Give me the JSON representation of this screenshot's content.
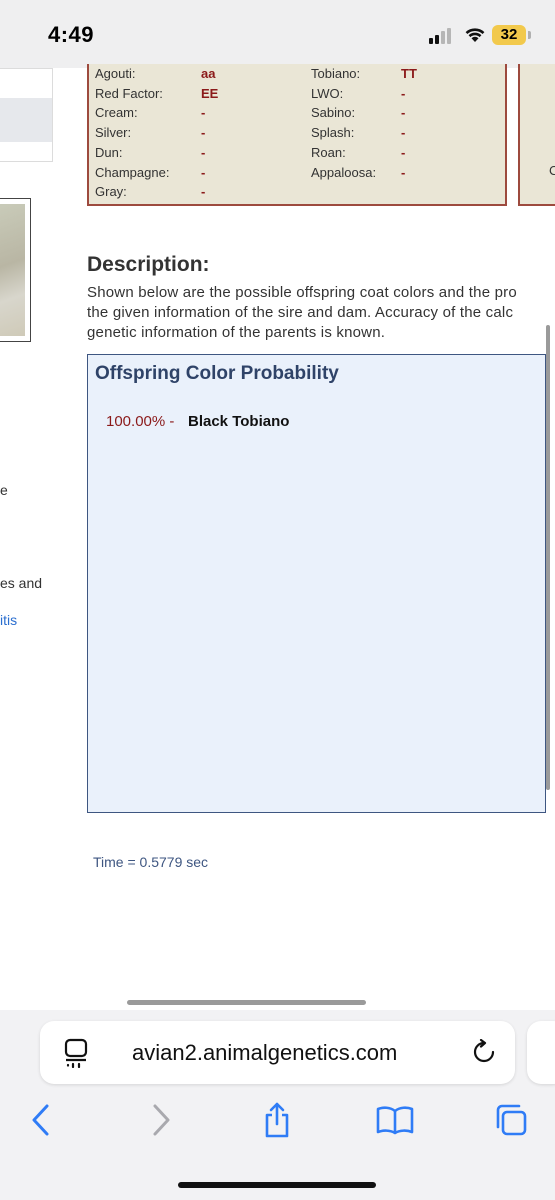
{
  "status_bar": {
    "time": "4:49",
    "battery": "32",
    "icons": [
      "signal-icon",
      "wifi-icon",
      "battery-icon"
    ]
  },
  "left_column": {
    "text_1": "e",
    "text_2": "es and",
    "link_3": "itis"
  },
  "genetics": {
    "left": [
      {
        "label": "Agouti:",
        "value": "aa"
      },
      {
        "label": "Red Factor:",
        "value": "EE"
      },
      {
        "label": "Cream:",
        "value": "-"
      },
      {
        "label": "Silver:",
        "value": "-"
      },
      {
        "label": "Dun:",
        "value": "-"
      },
      {
        "label": "Champagne:",
        "value": "-"
      },
      {
        "label": "Gray:",
        "value": "-"
      }
    ],
    "right": [
      {
        "label": "Tobiano:",
        "value": "TT"
      },
      {
        "label": "LWO:",
        "value": "-"
      },
      {
        "label": "Sabino:",
        "value": "-"
      },
      {
        "label": "Splash:",
        "value": "-"
      },
      {
        "label": "Roan:",
        "value": "-"
      },
      {
        "label": "Appaloosa:",
        "value": "-"
      }
    ],
    "clipped_letter": "C"
  },
  "description": {
    "title": "Description:",
    "lines": [
      "Shown below are the possible offspring coat colors and the pro",
      "the given information of the sire and dam. Accuracy of the calc",
      "genetic information of the parents is known."
    ]
  },
  "offspring": {
    "title": "Offspring Color Probability",
    "results": [
      {
        "percent": "100.00% -",
        "color": "Black Tobiano"
      }
    ]
  },
  "timing": "Time = 0.5779 sec",
  "browser": {
    "url": "avian2.animalgenetics.com",
    "icons": [
      "tab-overview-icon",
      "reload-icon",
      "back-icon",
      "forward-icon",
      "share-icon",
      "bookmarks-icon",
      "tabs-icon"
    ]
  },
  "colors": {
    "gene_box_bg": "#eae6d6",
    "gene_box_border": "#9d4a3e",
    "gene_value": "#8b1a1a",
    "offspring_bg": "#eaf1fb",
    "offspring_title": "#2f4368",
    "link_blue": "#2a6ecf",
    "ios_blue": "#2f7cf6"
  }
}
